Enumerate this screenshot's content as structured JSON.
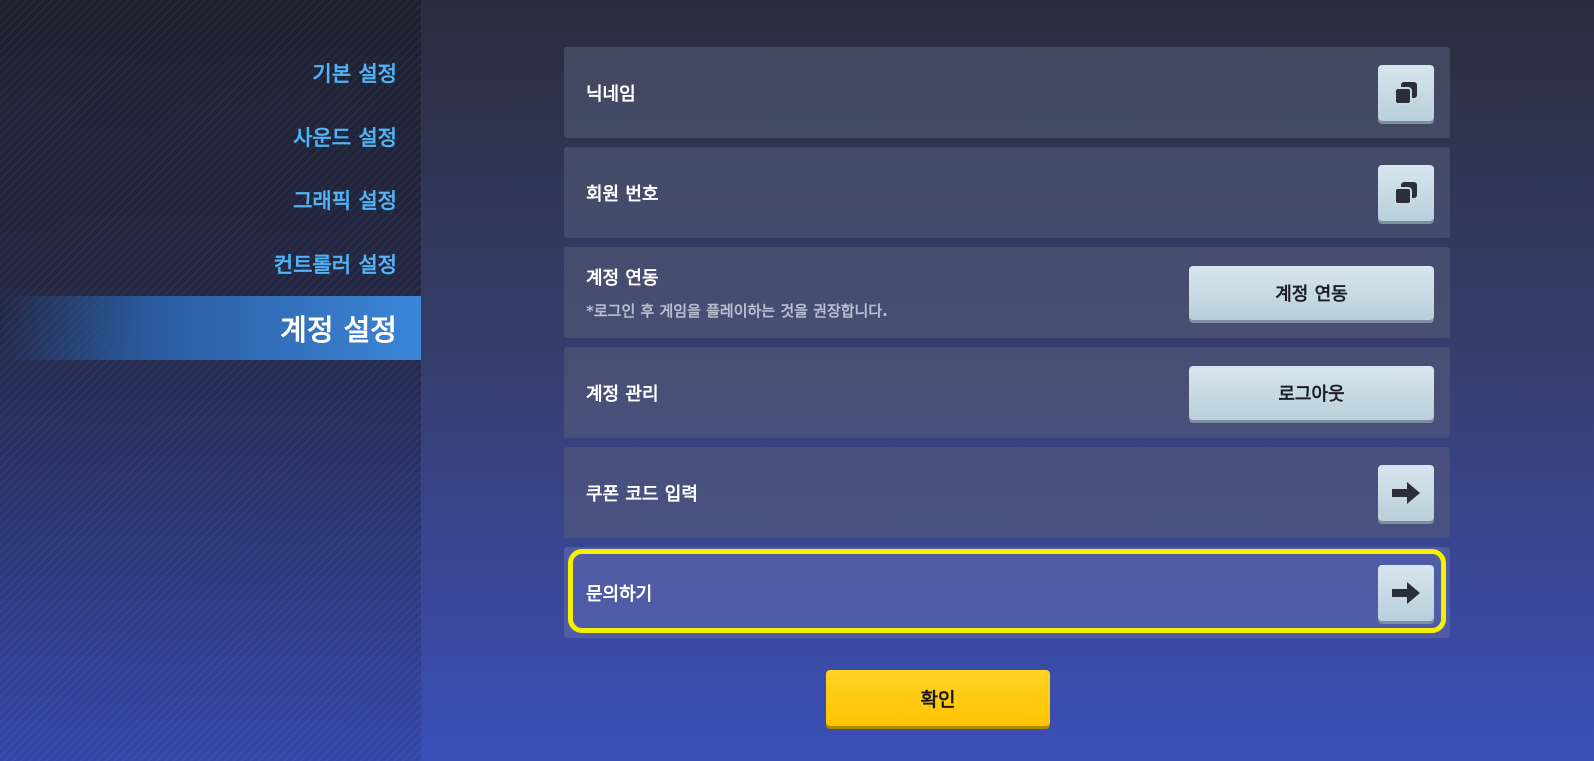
{
  "sidebar": {
    "items": [
      {
        "label": "기본 설정"
      },
      {
        "label": "사운드 설정"
      },
      {
        "label": "그래픽 설정"
      },
      {
        "label": "컨트롤러 설정"
      },
      {
        "label": "계정 설정"
      }
    ]
  },
  "rows": {
    "nickname": {
      "label": "닉네임",
      "icon": "copy-icon"
    },
    "member_number": {
      "label": "회원 번호",
      "icon": "copy-icon"
    },
    "link_account": {
      "label": "계정 연동",
      "sub": "*로그인 후 게임을 플레이하는 것을 권장합니다.",
      "button": "계정 연동"
    },
    "manage_account": {
      "label": "계정 관리",
      "button": "로그아웃"
    },
    "coupon": {
      "label": "쿠폰 코드 입력",
      "icon": "arrow-right-icon"
    },
    "inquiry": {
      "label": "문의하기",
      "icon": "arrow-right-icon"
    }
  },
  "footer": {
    "confirm_label": "확인"
  },
  "colors": {
    "accent": "#4fb3f6",
    "highlight": "#f5f000",
    "confirm": "#ffd326"
  }
}
